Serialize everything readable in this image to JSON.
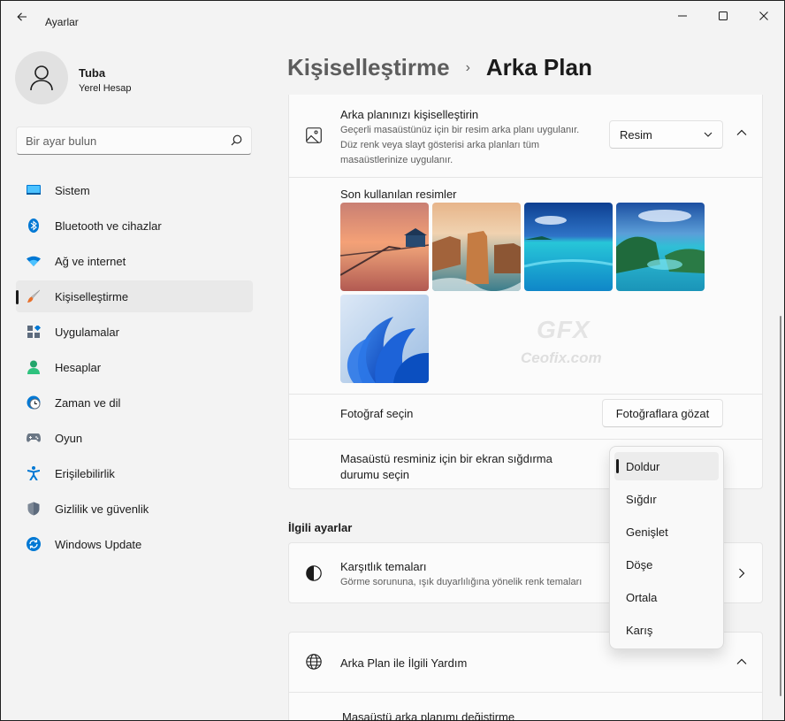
{
  "window": {
    "title": "Ayarlar",
    "controls": [
      "minimize",
      "maximize",
      "close"
    ]
  },
  "profile": {
    "name": "Tuba",
    "account_type": "Yerel Hesap"
  },
  "search": {
    "placeholder": "Bir ayar bulun"
  },
  "sidebar": {
    "items": [
      {
        "label": "Sistem",
        "icon": "monitor-icon",
        "active": false
      },
      {
        "label": "Bluetooth ve cihazlar",
        "icon": "bluetooth-icon",
        "active": false
      },
      {
        "label": "Ağ ve internet",
        "icon": "wifi-icon",
        "active": false
      },
      {
        "label": "Kişiselleştirme",
        "icon": "brush-icon",
        "active": true
      },
      {
        "label": "Uygulamalar",
        "icon": "apps-icon",
        "active": false
      },
      {
        "label": "Hesaplar",
        "icon": "person-icon",
        "active": false
      },
      {
        "label": "Zaman ve dil",
        "icon": "clock-globe-icon",
        "active": false
      },
      {
        "label": "Oyun",
        "icon": "gamepad-icon",
        "active": false
      },
      {
        "label": "Erişilebilirlik",
        "icon": "accessibility-icon",
        "active": false
      },
      {
        "label": "Gizlilik ve güvenlik",
        "icon": "shield-icon",
        "active": false
      },
      {
        "label": "Windows Update",
        "icon": "update-icon",
        "active": false
      }
    ]
  },
  "header": {
    "parent": "Kişiselleştirme",
    "separator": "›",
    "current": "Arka Plan"
  },
  "background_card": {
    "title": "Arka planınızı kişiselleştirin",
    "description": "Geçerli masaüstünüz için bir resim arka planı uygulanır. Düz renk veya slayt gösterisi arka planları tüm masaüstlerinize uygulanır.",
    "dropdown_value": "Resim",
    "recent_label": "Son kullanılan resimler",
    "choose_photo_label": "Fotoğraf seçin",
    "browse_button": "Fotoğraflara gözat",
    "fit_label": "Masaüstü resminiz için bir ekran sığdırma durumu seçin"
  },
  "watermark": {
    "logo": "GFX",
    "site": "Ceofix.com"
  },
  "fit_menu": {
    "options": [
      "Doldur",
      "Sığdır",
      "Genişlet",
      "Döşe",
      "Ortala",
      "Karış"
    ],
    "selected": "Doldur"
  },
  "related": {
    "heading": "İlgili ayarlar",
    "contrast_title": "Karşıtlık temaları",
    "contrast_desc": "Görme sorununa, ışık duyarlılığına yönelik renk temaları"
  },
  "help": {
    "title": "Arka Plan ile İlgili Yardım",
    "link": "Masaüstü arka planımı değiştirme"
  },
  "colors": {
    "accent": "#0067c0",
    "window_bg": "#f3f3f3",
    "card_bg": "#fbfbfb"
  }
}
